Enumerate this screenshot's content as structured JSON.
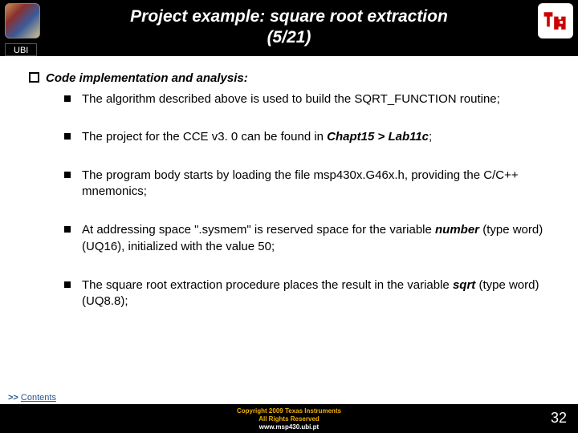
{
  "header": {
    "title_l1": "Project example: square root extraction",
    "title_l2": "(5/21)",
    "ubi": "UBI"
  },
  "content": {
    "heading": "Code implementation and analysis:",
    "b1": "The algorithm described above is used to build the SQRT_FUNCTION routine;",
    "b2_a": "The project for the CCE v3. 0 can be found in ",
    "b2_b": "Chapt15 > Lab11c",
    "b2_c": ";",
    "b3": "The program body starts by loading the file msp430x.G46x.h, providing the C/C++ mnemonics;",
    "b4_a": "At addressing space \".sysmem\" is reserved space for the variable ",
    "b4_b": "number",
    "b4_c": " (type word) (UQ16), initialized with the value 50;",
    "b5_a": "The square root extraction procedure places the result in the variable ",
    "b5_b": "sqrt",
    "b5_c": " (type word) (UQ8.8);"
  },
  "footer": {
    "contents_arrow": ">>",
    "contents_text": "Contents",
    "copy_l1": "Copyright  2009 Texas Instruments",
    "copy_l2": "All Rights Reserved",
    "www": "www.msp430.ubi.pt",
    "page": "32"
  }
}
